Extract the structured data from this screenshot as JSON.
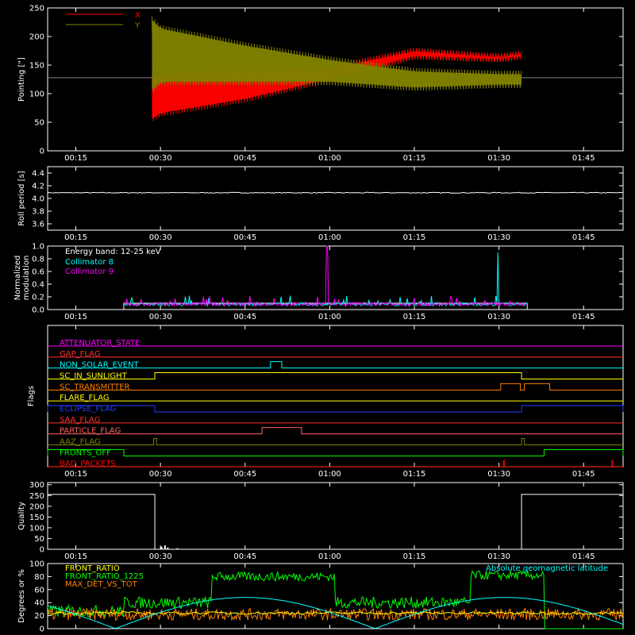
{
  "chart_data": [
    {
      "id": "pointing",
      "type": "line",
      "ylabel": "Pointing [\"]",
      "ylim": [
        0,
        250
      ],
      "yticks": [
        0,
        50,
        100,
        150,
        200,
        250
      ],
      "xlim_minutes": [
        10,
        112
      ],
      "xticks": [
        "00:15",
        "00:30",
        "00:45",
        "01:00",
        "01:15",
        "01:30",
        "01:45"
      ],
      "xtick_minutes": [
        15,
        30,
        45,
        60,
        75,
        90,
        105
      ],
      "series": [
        {
          "name": "X",
          "color": "#ff0000",
          "start_minute": 28.5,
          "end_minute": 94,
          "envelope": {
            "x": [
              28.5,
              30,
              45,
              60,
              75,
              90,
              94
            ],
            "upper": [
              130,
              135,
              140,
              150,
              180,
              170,
              175
            ],
            "lower": [
              50,
              60,
              85,
              120,
              160,
              155,
              160
            ]
          }
        },
        {
          "name": "Y",
          "color": "#808000",
          "start_minute": 28.5,
          "end_minute": 94,
          "envelope": {
            "x": [
              28.5,
              30,
              45,
              60,
              75,
              90,
              94
            ],
            "upper": [
              235,
              220,
              190,
              165,
              145,
              140,
              140
            ],
            "lower": [
              100,
              115,
              115,
              115,
              105,
              110,
              110
            ]
          }
        }
      ],
      "baseline": {
        "value": 128,
        "color": "#7a8a8a"
      }
    },
    {
      "id": "roll",
      "type": "line",
      "ylabel": "Roll period [s]",
      "ylim": [
        3.5,
        4.5
      ],
      "yticks": [
        "3.6",
        "3.8",
        "4.0",
        "4.2",
        "4.4"
      ],
      "ytick_values": [
        3.6,
        3.8,
        4.0,
        4.2,
        4.4
      ],
      "series": [
        {
          "name": "",
          "color": "#ffffff",
          "value": 4.09
        }
      ]
    },
    {
      "id": "modulation",
      "type": "line",
      "ylabel": "Normalized modulation",
      "ylim": [
        0,
        1
      ],
      "yticks": [
        "0.0",
        "0.2",
        "0.4",
        "0.6",
        "0.8",
        "1.0"
      ],
      "ytick_values": [
        0,
        0.2,
        0.4,
        0.6,
        0.8,
        1.0
      ],
      "annotations": [
        "Energy band: 12-25 keV"
      ],
      "series": [
        {
          "name": "Collimator 8",
          "color": "#00ffff",
          "start_minute": 23.5,
          "end_minute": 95,
          "spike": {
            "minute": 89.8,
            "value": 0.9
          }
        },
        {
          "name": "Collimator 9",
          "color": "#ff00ff",
          "start_minute": 23.5,
          "end_minute": 95,
          "spike": {
            "minute": 59.5,
            "value": 1.0
          }
        }
      ]
    },
    {
      "id": "flags",
      "type": "line",
      "ylabel": "Flags",
      "series": [
        {
          "name": "ATTENUATOR_STATE",
          "color": "#ff00ff",
          "segments": []
        },
        {
          "name": "GAP_FLAG",
          "color": "#ff3030",
          "segments": []
        },
        {
          "name": "NON_SOLAR_EVENT",
          "color": "#00ffff",
          "segments": [
            [
              49.5,
              51.5
            ]
          ]
        },
        {
          "name": "SC_IN_SUNLIGHT",
          "color": "#ffff00",
          "segments": [
            [
              29,
              94
            ]
          ]
        },
        {
          "name": "SC_TRANSMITTER",
          "color": "#ff8000",
          "segments": [
            [
              90.3,
              93.8
            ],
            [
              94.5,
              99
            ]
          ]
        },
        {
          "name": "FLARE_FLAG",
          "color": "#ffff00",
          "segments": []
        },
        {
          "name": "ECLIPSE_FLAG",
          "color": "#2040ff",
          "segments": [
            [
              10,
              29
            ],
            [
              94,
              112
            ]
          ]
        },
        {
          "name": "SAA_FLAG",
          "color": "#ff3030",
          "segments": []
        },
        {
          "name": "PARTICLE_FLAG",
          "color": "#ff6060",
          "segments": [
            [
              48,
              55
            ]
          ]
        },
        {
          "name": "AAZ_FLAG",
          "color": "#808000",
          "segments": [
            [
              28.8,
              29.3
            ],
            [
              94,
              94.5
            ]
          ]
        },
        {
          "name": "FRONTS_OFF",
          "color": "#00ff00",
          "segments": [
            [
              10,
              23.5
            ],
            [
              98,
              112
            ]
          ]
        },
        {
          "name": "BAD_PACKETS",
          "color": "#ff0000",
          "segments": [
            [
              90.8,
              91
            ],
            [
              110,
              110.2
            ]
          ]
        }
      ]
    },
    {
      "id": "quality",
      "type": "line",
      "ylabel": "Quality",
      "ylim": [
        0,
        310
      ],
      "yticks": [
        0,
        50,
        100,
        150,
        200,
        250,
        300
      ],
      "series": [
        {
          "name": "",
          "color": "#ffffff",
          "high": 255,
          "gap": [
            29,
            94
          ]
        }
      ]
    },
    {
      "id": "ratios",
      "type": "line",
      "ylabel": "Degrees or %",
      "ylim": [
        0,
        100
      ],
      "yticks": [
        0,
        20,
        40,
        60,
        80,
        100
      ],
      "series": [
        {
          "name": "FRONT_RATIO",
          "color": "#ffff00",
          "level": 24
        },
        {
          "name": "FRONT_RATIO_1225",
          "color": "#00ff00",
          "steps": [
            [
              10,
              27
            ],
            [
              23.5,
              27
            ],
            [
              23.5,
              40
            ],
            [
              39,
              40
            ],
            [
              39,
              60
            ],
            [
              39,
              80
            ],
            [
              61,
              80
            ],
            [
              61,
              40
            ],
            [
              85,
              40
            ],
            [
              85,
              60
            ],
            [
              85,
              82
            ],
            [
              98,
              82
            ],
            [
              98,
              0
            ],
            [
              112,
              0
            ]
          ]
        },
        {
          "name": "MAX_DET_VS_TOT",
          "color": "#ff8000",
          "level": 22
        },
        {
          "name": "Absolute geomagnetic latitude",
          "color": "#00ffff",
          "curve": true
        }
      ]
    }
  ]
}
